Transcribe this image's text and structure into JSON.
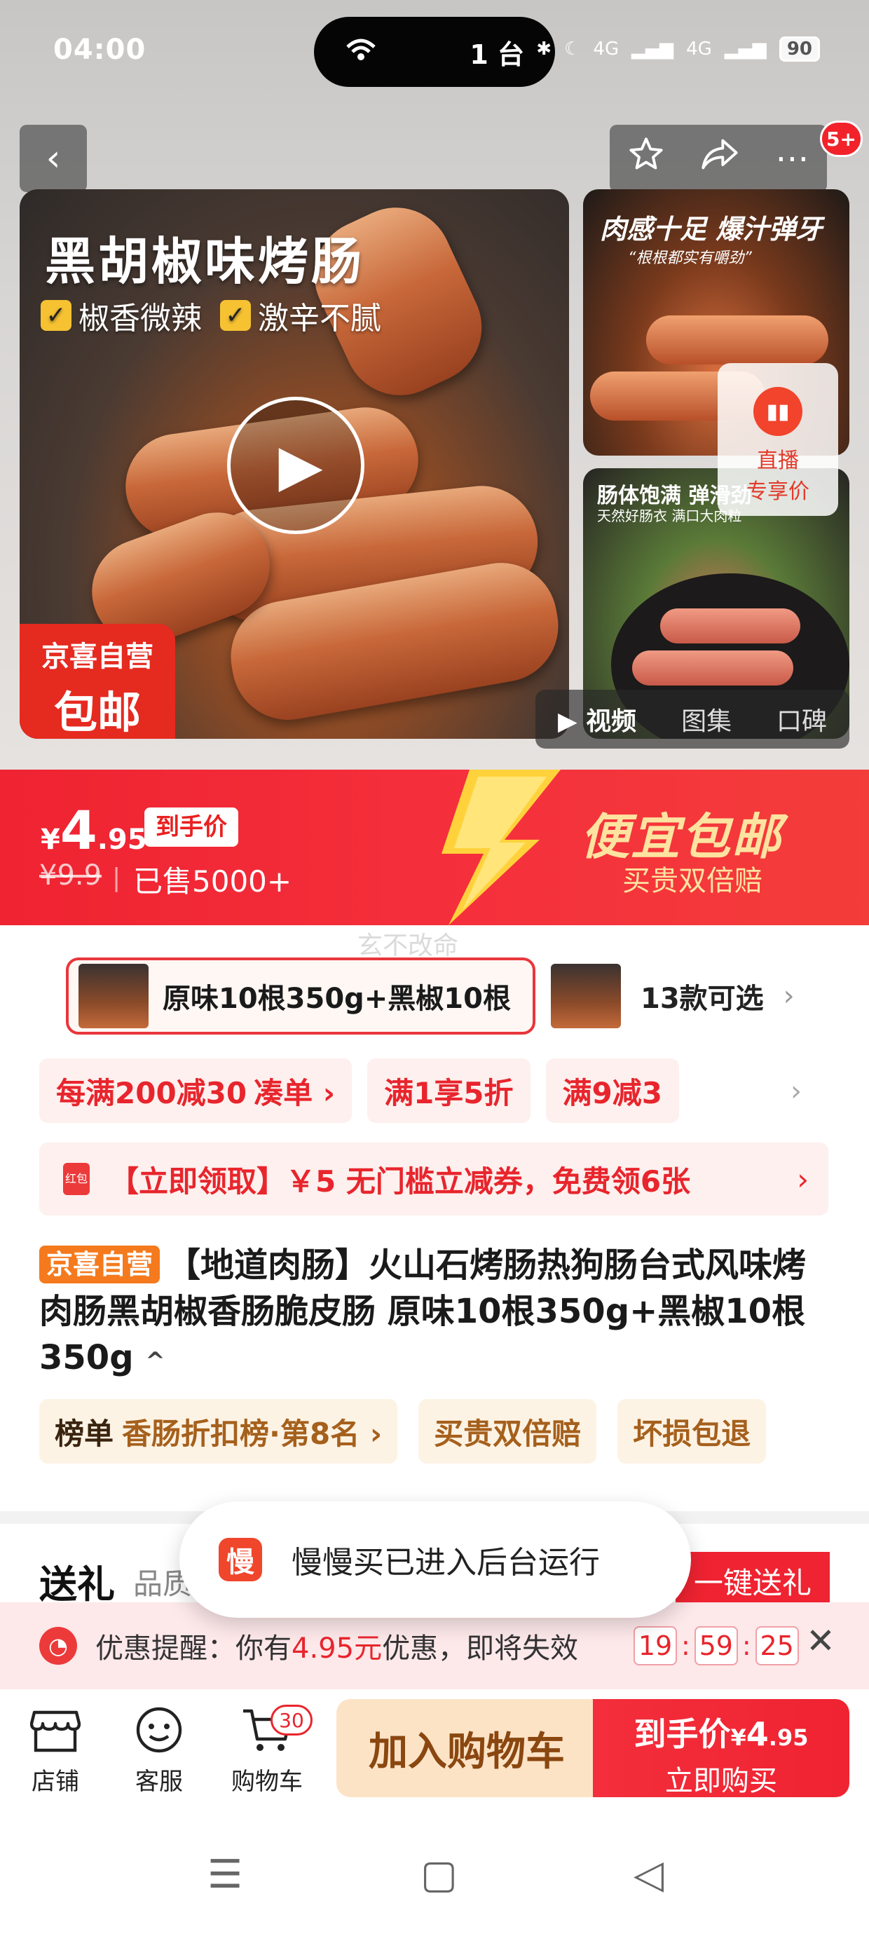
{
  "status": {
    "time": "04:00",
    "pill_text": "1 台",
    "pill_icon": "hotspot-icon",
    "network": "4G",
    "battery": "90"
  },
  "nav": {
    "back_icon": "back-arrow-icon",
    "favorite_icon": "star-icon",
    "share_icon": "share-icon",
    "more_icon": "more-icon",
    "badge": "5+"
  },
  "gallery": {
    "main_headline": "黑胡椒味烤肠",
    "features": [
      "椒香微辣",
      "激辛不腻"
    ],
    "main_tag_line1": "京喜自营",
    "main_tag_line2": "包邮",
    "side1_headline": "肉感十足 爆汁弹牙",
    "side1_sub": "“根根都实有嚼劲”",
    "side2_headline": "肠体饱满 弹滑劲",
    "side2_sub": "天然好肠衣 满口大肉粒",
    "live_line1": "直播",
    "live_line2": "专享价",
    "media_tabs": [
      "视频",
      "图集",
      "口碑"
    ]
  },
  "price": {
    "currency": "¥",
    "integer": "4",
    "decimal": ".95",
    "chip": "到手价",
    "original": "¥9.9",
    "sold": "已售5000+",
    "slogan": "便宜包邮",
    "slogan_sub": "买贵双倍赔",
    "brand_color": "#ef2331"
  },
  "watermark": "玄不改命",
  "variants": {
    "selected": "原味10根350g+黑椒10根",
    "more": "13款可选"
  },
  "promos": [
    {
      "label": "每满200减30",
      "link": "凑单 ›"
    },
    {
      "label": "满1享5折"
    },
    {
      "label": "满9减3"
    }
  ],
  "coupon": {
    "icon_text": "红包",
    "text": "【立即领取】￥5 无门槛立减券，免费领6张"
  },
  "product": {
    "badge": "京喜自营",
    "title": "【地道肉肠】火山石烤肠热狗肠台式风味烤肉肠黑胡椒香肠脆皮肠 原味10根350g+黑椒10根350g",
    "caret": "^"
  },
  "tags": {
    "rank_key": "榜单",
    "rank_value": "香肠折扣榜·第8名 ›",
    "t2": "买贵双倍赔",
    "t3": "坏损包退"
  },
  "gift": {
    "title": "送礼",
    "sub": "品质",
    "button": "一键送礼"
  },
  "toast": {
    "icon_text": "慢",
    "text": "慢慢买已进入后台运行"
  },
  "reminder": {
    "prefix": "优惠提醒：你有",
    "amount": "4.95元",
    "suffix": "优惠，即将失效",
    "hh": "19",
    "mm": "59",
    "ss": "25",
    "colon": ":"
  },
  "bottom": {
    "store": "店铺",
    "service": "客服",
    "cart": "购物车",
    "cart_count": "30",
    "add_cart": "加入购物车",
    "buy_price_label": "到手价",
    "buy_price_currency": "¥",
    "buy_price_int": "4",
    "buy_price_dec": ".95",
    "buy_now": "立即购买"
  }
}
